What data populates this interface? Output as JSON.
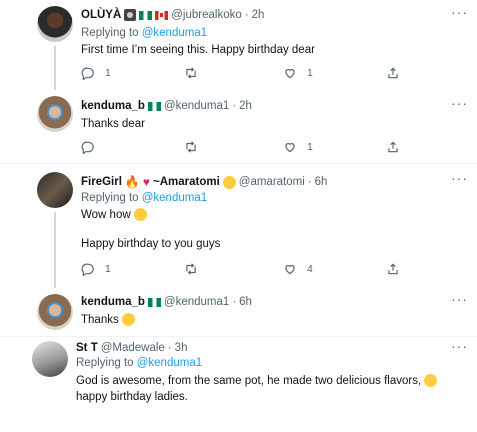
{
  "tweets": [
    {
      "name": "OLÙYÀ",
      "handle": "@jubrealkoko",
      "time": "2h",
      "replying_prefix": "Replying to ",
      "replying_to": "@kenduma1",
      "text": "First time I’m seeing this. Happy birthday dear",
      "replies": "1",
      "retweets": "",
      "likes": "1"
    },
    {
      "name": "kenduma_b",
      "handle": "@kenduma1",
      "time": "2h",
      "text": "Thanks dear",
      "replies": "",
      "retweets": "",
      "likes": "1"
    },
    {
      "name": "FireGirl",
      "name_suffix": "~Amaratomi",
      "handle": "@amaratomi",
      "time": "6h",
      "replying_prefix": "Replying to ",
      "replying_to": "@kenduma1",
      "text_line1": "Wow how",
      "text_line2": "Happy birthday to you guys",
      "replies": "1",
      "retweets": "",
      "likes": "4"
    },
    {
      "name": "kenduma_b",
      "handle": "@kenduma1",
      "time": "6h",
      "text": "Thanks"
    },
    {
      "name": "St T",
      "handle": "@Madewale",
      "time": "3h",
      "replying_prefix": "Replying to ",
      "replying_to": "@kenduma1",
      "text_line1": "God is awesome, from the same pot, he made two delicious flavors,",
      "text_line2": "happy birthday ladies."
    }
  ],
  "separator": "·",
  "more_label": "···",
  "icons": {
    "reply": "reply-icon",
    "retweet": "retweet-icon",
    "like": "like-icon",
    "share": "share-icon"
  },
  "colors": {
    "accent": "#1d9bf0",
    "muted": "#536471",
    "thread_line": "#cfd9de"
  }
}
